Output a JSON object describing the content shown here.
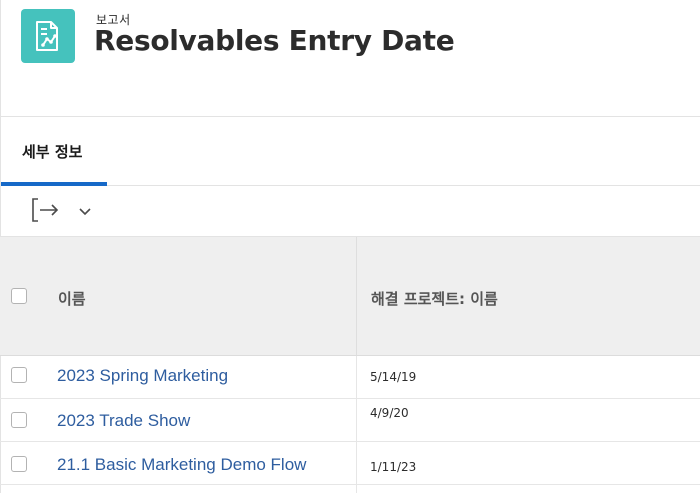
{
  "header": {
    "eyebrow": "보고서",
    "title": "Resolvables Entry Date",
    "icon": "report-chart-icon",
    "icon_color": "#45c2bd"
  },
  "tabs": [
    {
      "label": "세부 정보",
      "active": true
    }
  ],
  "toolbar": {
    "export_icon": "export-arrow-icon",
    "dropdown_icon": "chevron-down-icon"
  },
  "table": {
    "columns": [
      "이름",
      "해결 프로젝트: 이름"
    ],
    "rows": [
      {
        "name": "2023 Spring Marketing",
        "value": "5/14/19"
      },
      {
        "name": "2023 Trade Show",
        "value": "4/9/20"
      },
      {
        "name": "21.1 Basic Marketing Demo Flow",
        "value": "1/11/23"
      }
    ]
  },
  "colors": {
    "accent": "#1669c8",
    "link": "#2e5d9f",
    "header_bg": "#efefef"
  }
}
